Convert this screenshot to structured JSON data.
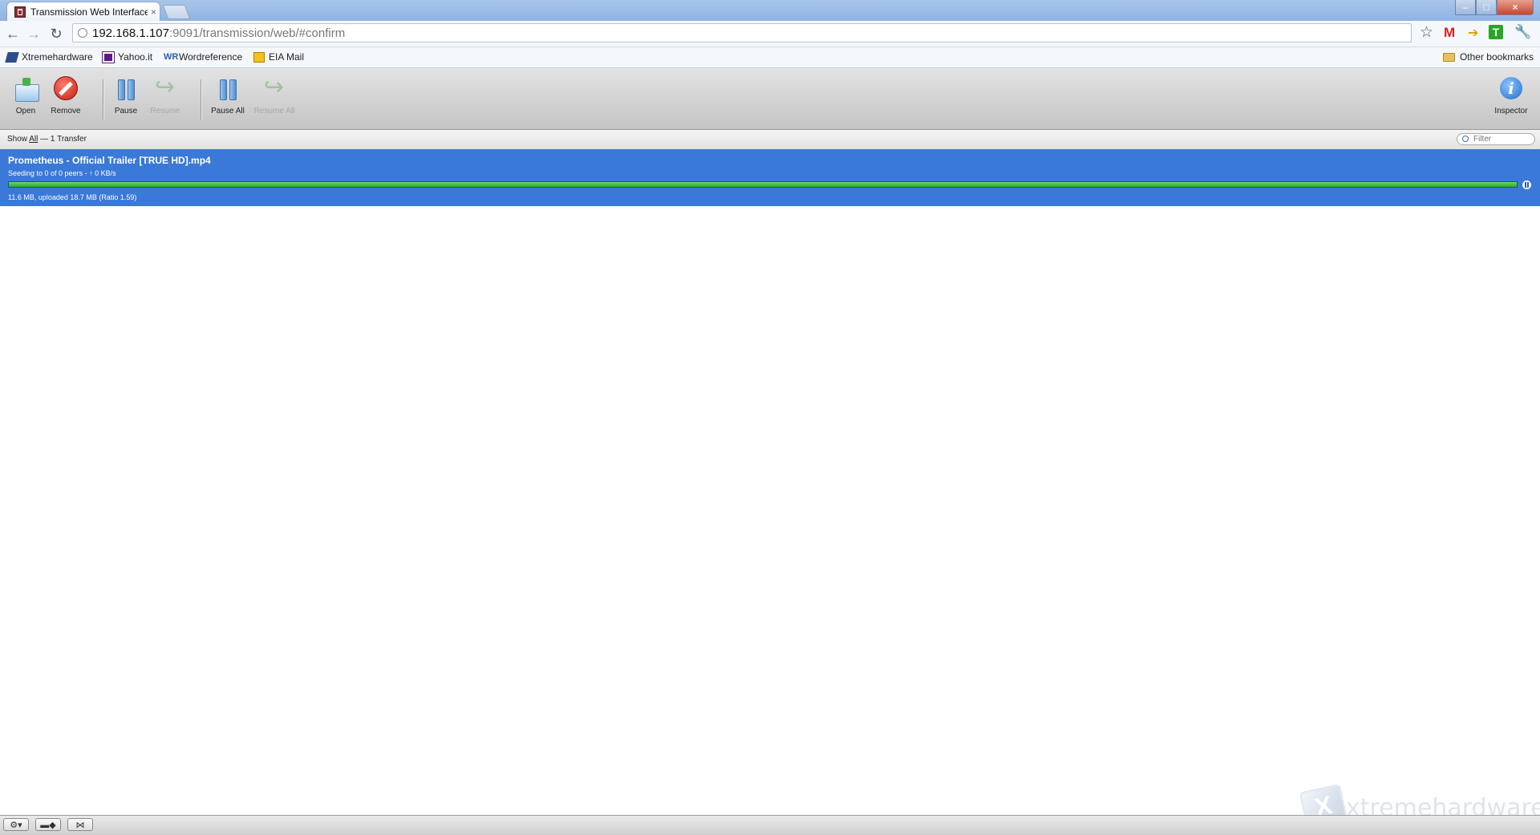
{
  "browser": {
    "tab_title": "Transmission Web Interface",
    "tab_close": "×",
    "url_host": "192.168.1.107",
    "url_path": ":9091/transmission/web/#confirm",
    "window_controls": {
      "minimize": "–",
      "maximize": "□",
      "close": "×"
    },
    "bookmarks": [
      {
        "label": "Xtremehardware"
      },
      {
        "label": "Yahoo.it"
      },
      {
        "label": "Wordreference"
      },
      {
        "label": "EIA Mail"
      }
    ],
    "other_bookmarks": "Other bookmarks",
    "extension_icons": [
      "gmail-icon",
      "arrow-icon",
      "t-icon",
      "wrench-icon"
    ]
  },
  "toolbar": {
    "open": "Open",
    "remove": "Remove",
    "pause": "Pause",
    "resume": "Resume",
    "pause_all": "Pause All",
    "resume_all": "Resume All",
    "inspector": "Inspector"
  },
  "filter": {
    "show": "Show ",
    "all": "All",
    "count": " — 1 Transfer",
    "placeholder": "Filter"
  },
  "torrent": {
    "name": "Prometheus - Official Trailer [TRUE HD].mp4",
    "peers": "Seeding to 0 of 0 peers - ↑ 0 KB/s",
    "progress_text": "11.6 MB, uploaded 18.7 MB (Ratio 1.59)",
    "progress_fraction": 1.0,
    "status_color": "#3a79d7",
    "bar_color": "#2ea82e"
  },
  "watermark": {
    "badge": "X",
    "text": "xtremehardware.it"
  },
  "bottom_bar": {
    "settings_icon": "gear-icon",
    "turtle_icon": "turtle-icon",
    "compact_icon": "compact-view-icon"
  }
}
